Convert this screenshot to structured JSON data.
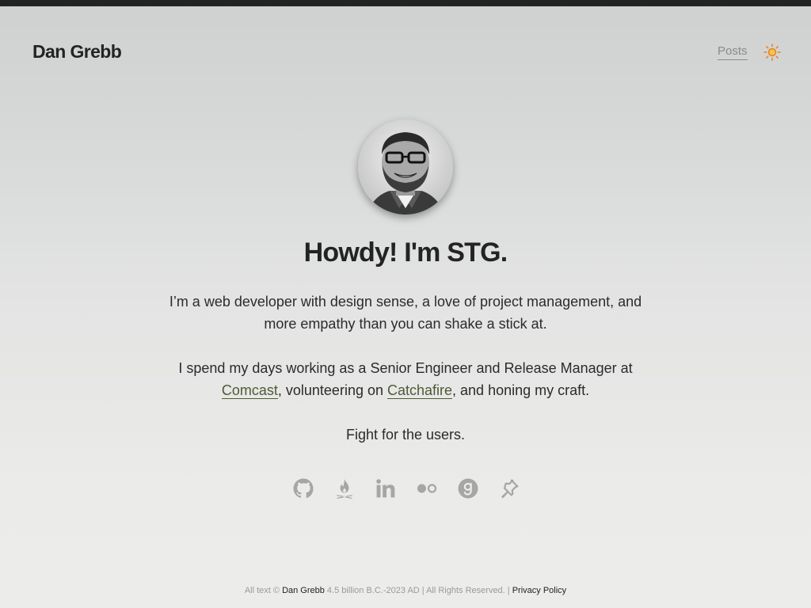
{
  "header": {
    "site_title": "Dan Grebb",
    "nav_posts": "Posts",
    "theme_toggle_icon": "sun-icon"
  },
  "main": {
    "avatar_alt": "Dan Grebb profile photo",
    "headline": "Howdy! I'm STG.",
    "bio_line_1": "I’m a web developer with design sense, a love of project management, and more empathy than you can shake a stick at.",
    "bio_2_prefix": "I spend my days working as a Senior Engineer and Release Manager at ",
    "bio_2_link_1": "Comcast",
    "bio_2_middle": ", volunteering on ",
    "bio_2_link_2": "Catchafire",
    "bio_2_suffix": ", and honing my craft.",
    "bio_line_3": "Fight for the users."
  },
  "socials": [
    {
      "name": "github-icon"
    },
    {
      "name": "campfire-icon"
    },
    {
      "name": "linkedin-icon"
    },
    {
      "name": "flickr-icon"
    },
    {
      "name": "goodreads-icon"
    },
    {
      "name": "pinboard-icon"
    }
  ],
  "footer": {
    "prefix": "All text © ",
    "author": "Dan Grebb",
    "middle": " 4.5 billion B.C.-2023 AD | All Rights Reserved. | ",
    "privacy": "Privacy Policy"
  },
  "colors": {
    "topbar": "#232323",
    "link": "#4e5a35",
    "icon_gray": "#a6a6a6",
    "sun_orange": "#e8832a"
  }
}
